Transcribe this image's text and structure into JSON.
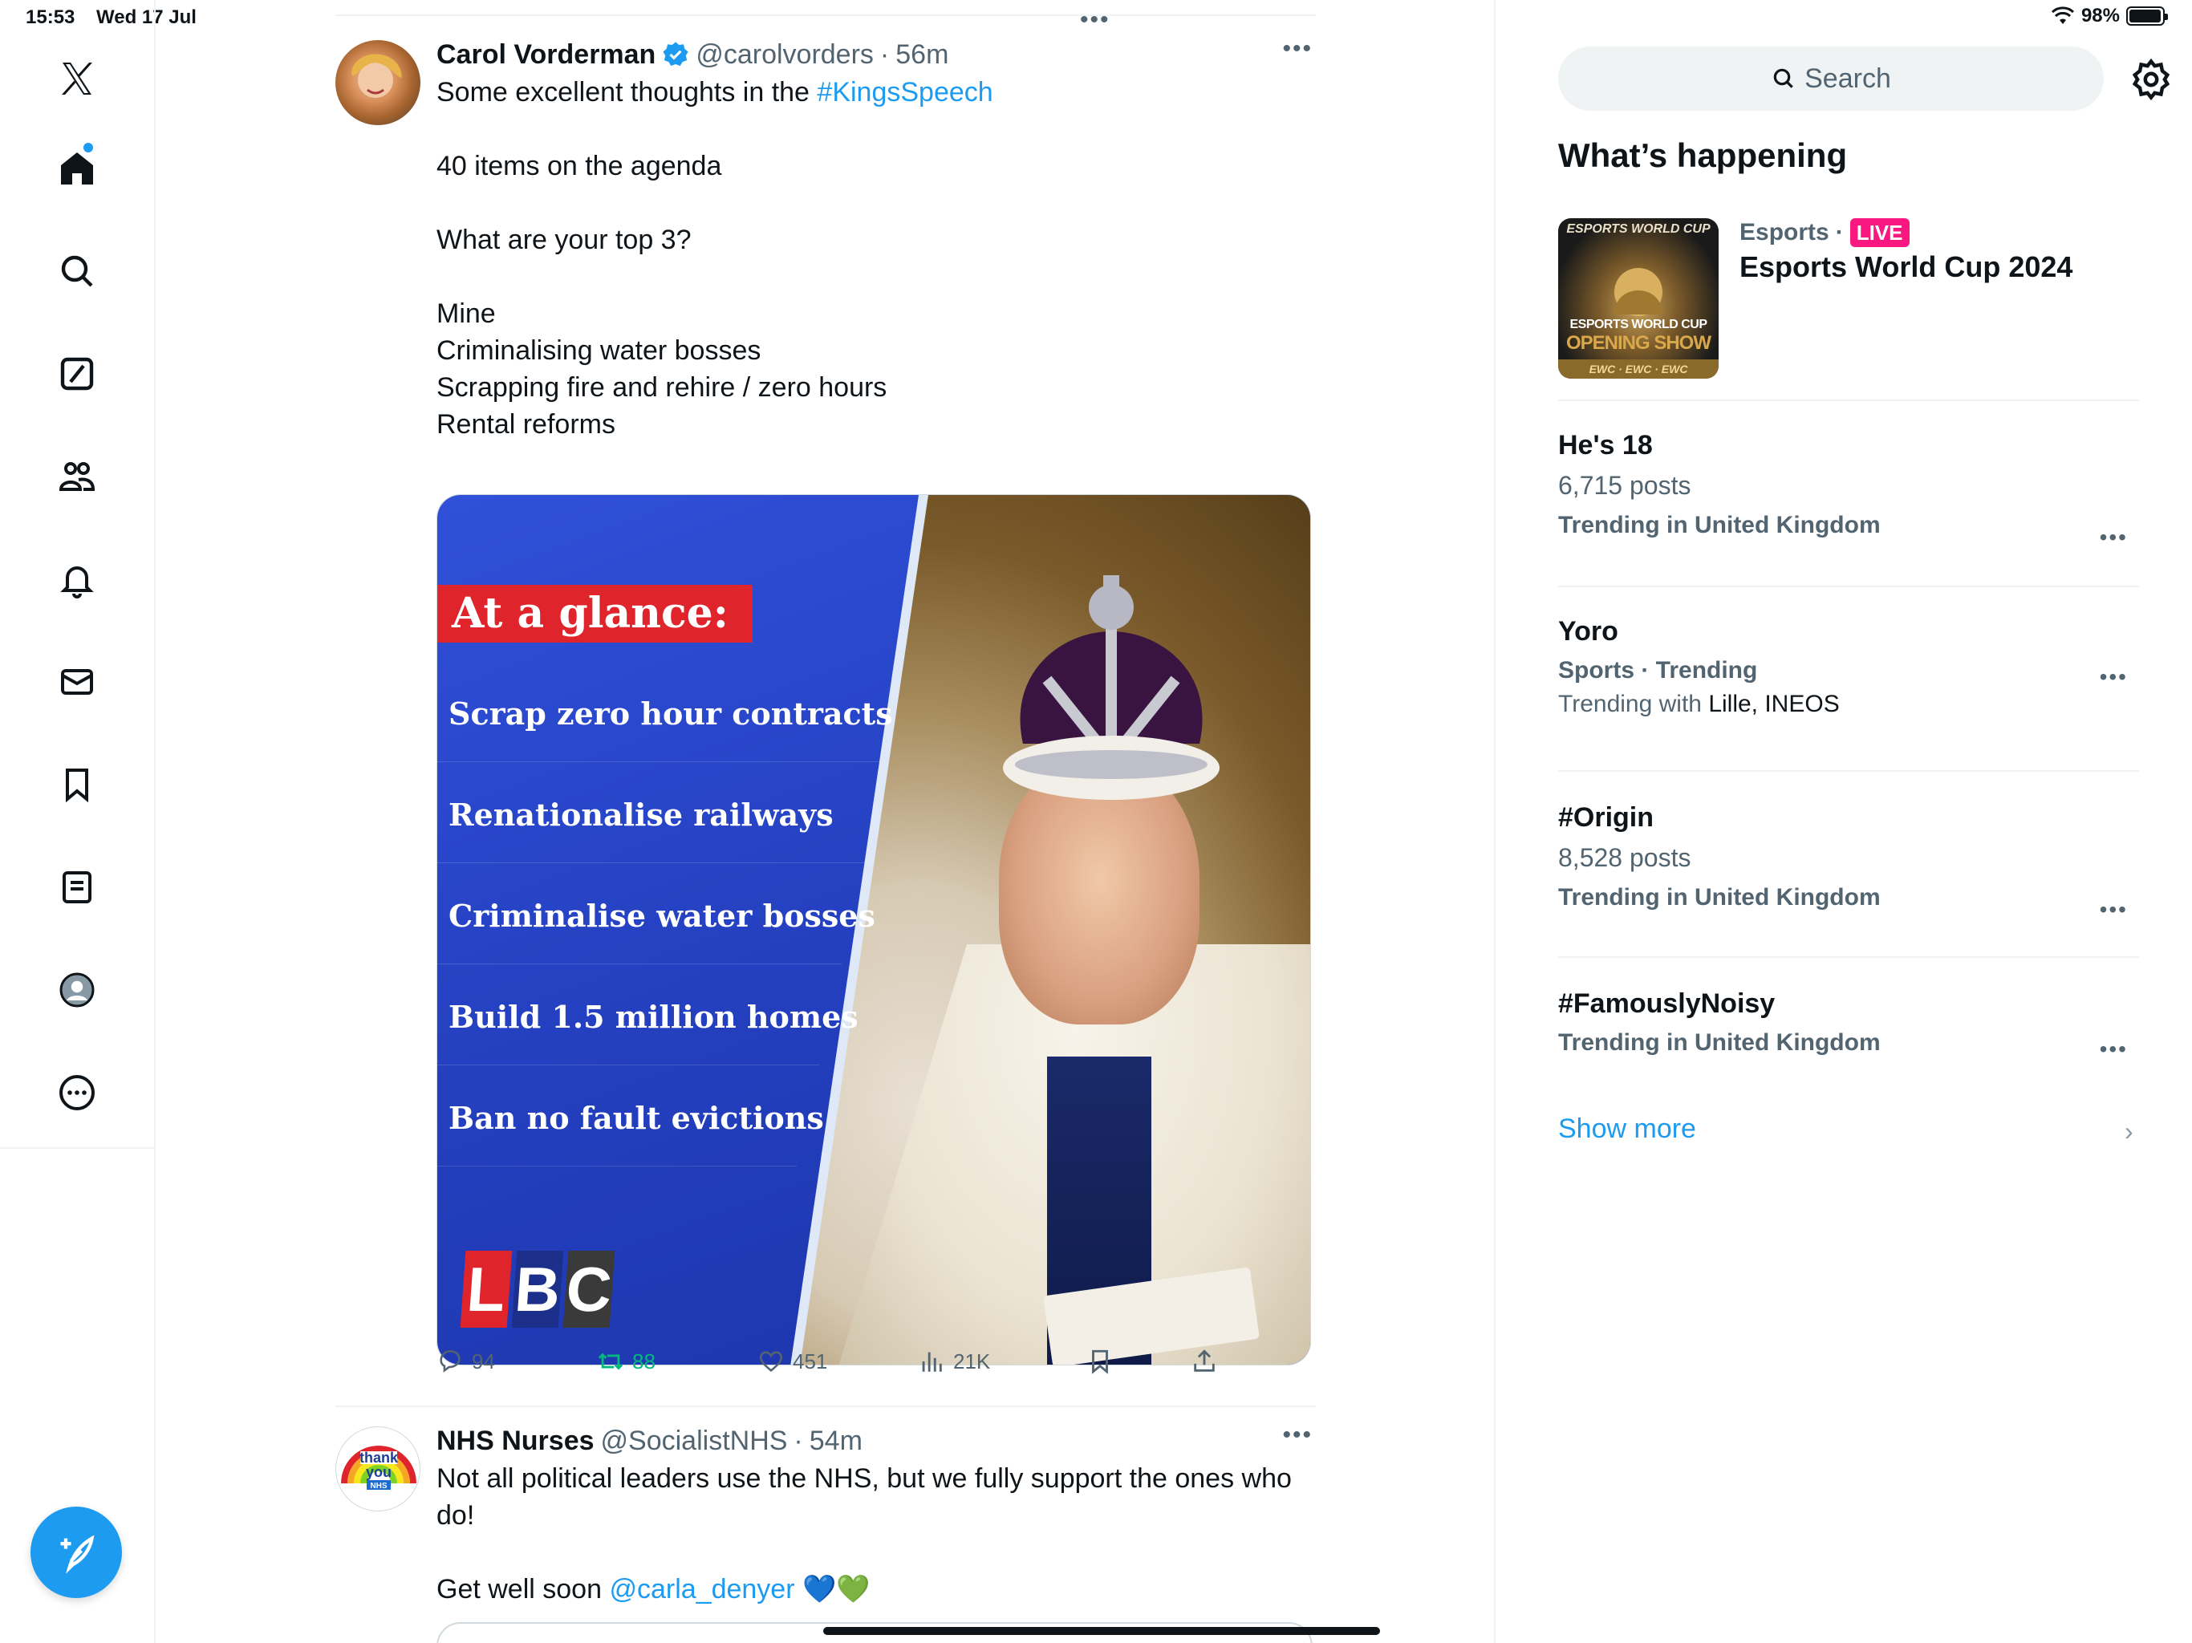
{
  "status_bar": {
    "time": "15:53",
    "date": "Wed 17 Jul",
    "battery": "98%",
    "battery_level": 0.98
  },
  "nav": {
    "items": [
      "Home",
      "Explore",
      "Grok",
      "Communities",
      "Notifications",
      "Messages",
      "Bookmarks",
      "Lists",
      "Profile",
      "More"
    ],
    "icons": [
      "x-logo-icon",
      "home-icon",
      "search-icon",
      "grok-icon",
      "communities-icon",
      "bell-icon",
      "mail-icon",
      "bookmark-icon",
      "list-icon",
      "profile-icon",
      "more-icon"
    ],
    "accent": "#1d9bf0"
  },
  "tweets": [
    {
      "name": "Carol Vorderman",
      "handle": "@carolvorders",
      "sep": "·",
      "time": "56m",
      "text_prefix": "Some excellent thoughts in the ",
      "hashtag": "#KingsSpeech",
      "text_rest": "40 items on the agenda\n\nWhat are your top 3?\n\nMine\nCriminalising water bosses\nScrapping fire and rehire / zero hours\nRental reforms",
      "media": {
        "heading": "At a glance:",
        "items": [
          "Scrap zero hour contracts",
          "Renationalise railways",
          "Criminalise water bosses",
          "Build 1.5 million homes",
          "Ban no fault evictions"
        ],
        "logo": [
          "L",
          "B",
          "C"
        ]
      },
      "actions": {
        "replies": "94",
        "retweets": "88",
        "likes": "451",
        "views": "21K"
      }
    },
    {
      "name": "NHS Nurses",
      "handle": "@SocialistNHS",
      "sep": "·",
      "time": "54m",
      "text_main": "Not all political leaders use the NHS, but we fully support the ones who do!",
      "text_prefix2": "Get well soon ",
      "mention": "@carla_denyer",
      "emoji": "💙💚"
    }
  ],
  "sidebar": {
    "search_placeholder": "Search",
    "title": "What’s happening",
    "featured": {
      "category": "Esports",
      "sep": "·",
      "live_label": "LIVE",
      "title": "Esports World Cup 2024",
      "thumb_top": "ESPORTS WORLD CUP",
      "thumb_label": "ESPORTS WORLD CUP",
      "thumb_label2": "OPENING SHOW",
      "thumb_strip": "EWC · EWC · EWC"
    },
    "trends": [
      {
        "title": "He's 18",
        "posts": "6,715 posts",
        "meta": "Trending in United Kingdom"
      },
      {
        "title": "Yoro",
        "meta": "Sports · Trending",
        "with_prefix": "Trending with ",
        "with_names": "Lille, INEOS"
      },
      {
        "title": "#Origin",
        "posts": "8,528 posts",
        "meta": "Trending in United Kingdom"
      },
      {
        "title": "#FamouslyNoisy",
        "meta": "Trending in United Kingdom"
      }
    ],
    "show_more": "Show more"
  }
}
